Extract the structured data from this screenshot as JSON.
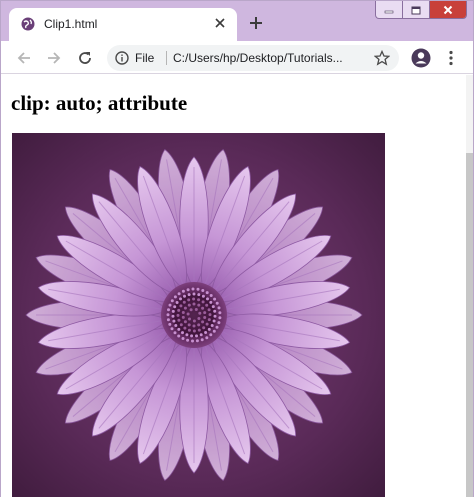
{
  "window": {
    "controls": [
      "minimize-icon",
      "maximize-icon",
      "close-icon"
    ]
  },
  "tab": {
    "title": "Clip1.html",
    "favicon": "globe-icon",
    "close_icon": "close-icon"
  },
  "toolbar": {
    "back_icon": "arrow-left-icon",
    "forward_icon": "arrow-right-icon",
    "reload_icon": "reload-icon",
    "info_icon": "info-icon",
    "scheme_label": "File",
    "url": "C:/Users/hp/Desktop/Tutorials...",
    "bookmark_icon": "star-icon",
    "profile_icon": "account-icon",
    "menu_icon": "kebab-menu-icon"
  },
  "page": {
    "heading": "clip: auto; attribute",
    "image_subject": "purple daisy flower"
  },
  "colors": {
    "tabstrip": "#cfb7df",
    "petal": "#c79ad9",
    "background_dark": "#4a1e47",
    "center": "#5a1d52"
  }
}
